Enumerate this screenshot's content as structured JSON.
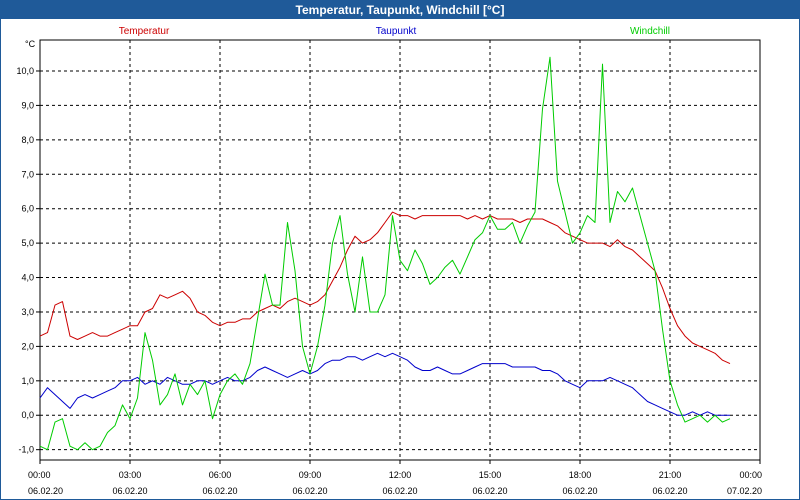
{
  "window": {
    "title": "Temperatur, Taupunkt, Windchill [°C]"
  },
  "chart_data": {
    "type": "line",
    "title": "Temperatur, Taupunkt, Windchill [°C]",
    "ylabel": "°C",
    "ylim": [
      -1.3,
      10.9
    ],
    "xlim": [
      0,
      24
    ],
    "grid": true,
    "legend_placement": "top",
    "y_ticks": [
      "-1,0",
      "0,0",
      "1,0",
      "2,0",
      "3,0",
      "4,0",
      "5,0",
      "6,0",
      "7,0",
      "8,0",
      "9,0",
      "10,0"
    ],
    "x_ticks": [
      {
        "time": "00:00",
        "date": "06.02.20"
      },
      {
        "time": "03:00",
        "date": "06.02.20"
      },
      {
        "time": "06:00",
        "date": "06.02.20"
      },
      {
        "time": "09:00",
        "date": "06.02.20"
      },
      {
        "time": "12:00",
        "date": "06.02.20"
      },
      {
        "time": "15:00",
        "date": "06.02.20"
      },
      {
        "time": "18:00",
        "date": "06.02.20"
      },
      {
        "time": "21:00",
        "date": "06.02.20"
      },
      {
        "time": "00:00",
        "date": "07.02.20"
      }
    ],
    "x_hours": [
      0,
      0.25,
      0.5,
      0.75,
      1,
      1.25,
      1.5,
      1.75,
      2,
      2.25,
      2.5,
      2.75,
      3,
      3.25,
      3.5,
      3.75,
      4,
      4.25,
      4.5,
      4.75,
      5,
      5.25,
      5.5,
      5.75,
      6,
      6.25,
      6.5,
      6.75,
      7,
      7.25,
      7.5,
      7.75,
      8,
      8.25,
      8.5,
      8.75,
      9,
      9.25,
      9.5,
      9.75,
      10,
      10.25,
      10.5,
      10.75,
      11,
      11.25,
      11.5,
      11.75,
      12,
      12.25,
      12.5,
      12.75,
      13,
      13.25,
      13.5,
      13.75,
      14,
      14.25,
      14.5,
      14.75,
      15,
      15.25,
      15.5,
      15.75,
      16,
      16.25,
      16.5,
      16.75,
      17,
      17.25,
      17.5,
      17.75,
      18,
      18.25,
      18.5,
      18.75,
      19,
      19.25,
      19.5,
      19.75,
      20,
      20.25,
      20.5,
      20.75,
      21,
      21.25,
      21.5,
      21.75,
      22,
      22.25,
      22.5,
      22.75,
      23,
      23.25,
      23.5,
      23.75,
      24
    ],
    "series": [
      {
        "name": "Temperatur",
        "color": "#cc0000",
        "values": [
          2.3,
          2.4,
          3.2,
          3.3,
          2.3,
          2.2,
          2.3,
          2.4,
          2.3,
          2.3,
          2.4,
          2.5,
          2.6,
          2.6,
          3.0,
          3.1,
          3.5,
          3.4,
          3.5,
          3.6,
          3.4,
          3.0,
          2.9,
          2.7,
          2.6,
          2.7,
          2.7,
          2.8,
          2.8,
          3.0,
          3.1,
          3.2,
          3.1,
          3.3,
          3.4,
          3.3,
          3.2,
          3.3,
          3.5,
          3.9,
          4.3,
          4.8,
          5.2,
          5.0,
          5.1,
          5.3,
          5.6,
          5.9,
          5.8,
          5.8,
          5.7,
          5.8,
          5.8,
          5.8,
          5.8,
          5.8,
          5.8,
          5.7,
          5.8,
          5.7,
          5.8,
          5.7,
          5.7,
          5.7,
          5.6,
          5.7,
          5.7,
          5.7,
          5.6,
          5.5,
          5.3,
          5.2,
          5.1,
          5.0,
          5.0,
          5.0,
          4.9,
          5.1,
          4.9,
          4.8,
          4.6,
          4.4,
          4.2,
          3.7,
          3.1,
          2.6,
          2.3,
          2.1,
          2.0,
          1.9,
          1.8,
          1.6,
          1.5
        ]
      },
      {
        "name": "Taupunkt",
        "color": "#0000cc",
        "values": [
          0.5,
          0.8,
          0.6,
          0.4,
          0.2,
          0.5,
          0.6,
          0.5,
          0.6,
          0.7,
          0.8,
          1.0,
          1.0,
          1.1,
          0.9,
          1.0,
          0.9,
          1.1,
          1.0,
          0.9,
          0.9,
          1.0,
          1.0,
          0.9,
          1.0,
          1.1,
          1.0,
          1.0,
          1.1,
          1.3,
          1.4,
          1.3,
          1.2,
          1.1,
          1.2,
          1.3,
          1.2,
          1.3,
          1.5,
          1.6,
          1.6,
          1.7,
          1.7,
          1.6,
          1.7,
          1.8,
          1.7,
          1.8,
          1.7,
          1.6,
          1.4,
          1.3,
          1.3,
          1.4,
          1.3,
          1.2,
          1.2,
          1.3,
          1.4,
          1.5,
          1.5,
          1.5,
          1.5,
          1.4,
          1.4,
          1.4,
          1.4,
          1.3,
          1.3,
          1.2,
          1.0,
          0.9,
          0.8,
          1.0,
          1.0,
          1.0,
          1.1,
          1.0,
          0.9,
          0.8,
          0.6,
          0.4,
          0.3,
          0.2,
          0.1,
          0.0,
          0.0,
          0.1,
          0.0,
          0.1,
          0.0,
          0.0,
          0.0
        ]
      },
      {
        "name": "Windchill",
        "color": "#00cc00",
        "values": [
          -0.9,
          -1.0,
          -0.2,
          -0.1,
          -0.9,
          -1.0,
          -0.8,
          -1.0,
          -0.9,
          -0.5,
          -0.3,
          0.3,
          -0.1,
          0.5,
          2.4,
          1.6,
          0.3,
          0.6,
          1.2,
          0.3,
          0.9,
          0.6,
          1.0,
          -0.1,
          0.6,
          1.0,
          1.2,
          0.9,
          1.5,
          2.8,
          4.1,
          3.2,
          3.2,
          5.6,
          4.2,
          2.0,
          1.2,
          2.0,
          3.2,
          5.0,
          5.8,
          4.1,
          3.0,
          4.6,
          3.0,
          3.0,
          3.5,
          5.8,
          4.5,
          4.2,
          4.8,
          4.4,
          3.8,
          4.0,
          4.3,
          4.5,
          4.1,
          4.6,
          5.1,
          5.3,
          5.8,
          5.4,
          5.4,
          5.6,
          5.0,
          5.5,
          5.9,
          8.9,
          10.4,
          6.8,
          5.9,
          5.0,
          5.3,
          5.8,
          5.6,
          10.2,
          5.6,
          6.5,
          6.2,
          6.6,
          5.8,
          5.0,
          4.2,
          2.5,
          1.0,
          0.3,
          -0.2,
          -0.1,
          0.0,
          -0.2,
          0.0,
          -0.2,
          -0.1
        ]
      }
    ]
  }
}
